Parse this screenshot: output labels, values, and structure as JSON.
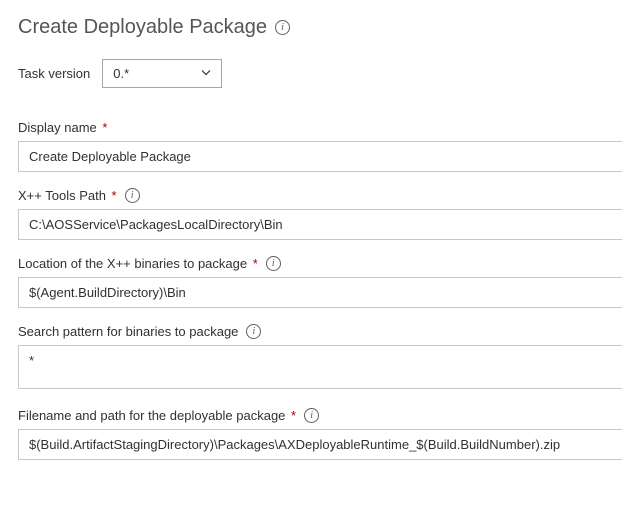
{
  "header": {
    "title": "Create Deployable Package"
  },
  "taskVersion": {
    "label": "Task version",
    "value": "0.*"
  },
  "fields": {
    "displayName": {
      "label": "Display name",
      "required": true,
      "value": "Create Deployable Package"
    },
    "xppToolsPath": {
      "label": "X++ Tools Path",
      "required": true,
      "value": "C:\\AOSService\\PackagesLocalDirectory\\Bin"
    },
    "xppBinariesLocation": {
      "label": "Location of the X++ binaries to package",
      "required": true,
      "value": "$(Agent.BuildDirectory)\\Bin"
    },
    "searchPattern": {
      "label": "Search pattern for binaries to package",
      "required": false,
      "value": "*"
    },
    "packageFilename": {
      "label": "Filename and path for the deployable package",
      "required": true,
      "value": "$(Build.ArtifactStagingDirectory)\\Packages\\AXDeployableRuntime_$(Build.BuildNumber).zip"
    }
  }
}
